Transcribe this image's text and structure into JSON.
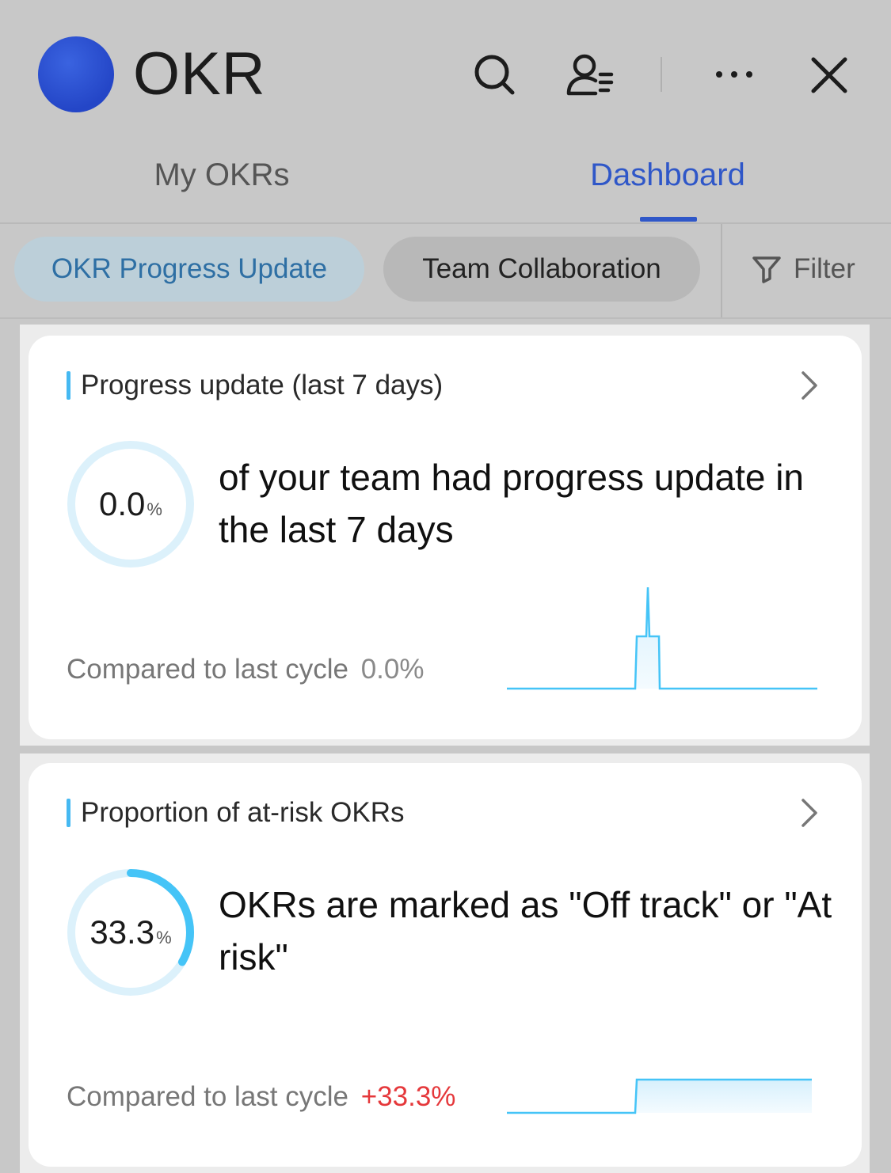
{
  "header": {
    "title": "OKR",
    "icons": [
      "search-icon",
      "user-list-icon",
      "more-icon",
      "close-icon"
    ]
  },
  "tabs": [
    {
      "label": "My OKRs",
      "active": false
    },
    {
      "label": "Dashboard",
      "active": true
    }
  ],
  "filter_chips": [
    {
      "label": "OKR Progress Update",
      "selected": true
    },
    {
      "label": "Team Collaboration",
      "selected": false
    }
  ],
  "filter": {
    "label": "Filter",
    "icon": "filter-icon"
  },
  "cards": [
    {
      "title": "Progress update (last 7 days)",
      "percent_value": "0.0",
      "percent_unit": "%",
      "ring_fraction": 0.0,
      "description": "of your team had progress update in the last 7 days",
      "compare_label": "Compared to last cycle",
      "compare_value": "0.0%",
      "compare_color": "#8a8a8a"
    },
    {
      "title": "Proportion of at-risk OKRs",
      "percent_value": "33.3",
      "percent_unit": "%",
      "ring_fraction": 0.333,
      "description": "OKRs are marked as \"Off track\" or \"At risk\"",
      "compare_label": "Compared to last cycle",
      "compare_value": "+33.3%",
      "compare_color": "#e5383b"
    }
  ],
  "colors": {
    "accent": "#2f57c8",
    "ring_track": "#dcf1fb",
    "ring_fill": "#45c4f7",
    "spark_line": "#45c4f7"
  }
}
